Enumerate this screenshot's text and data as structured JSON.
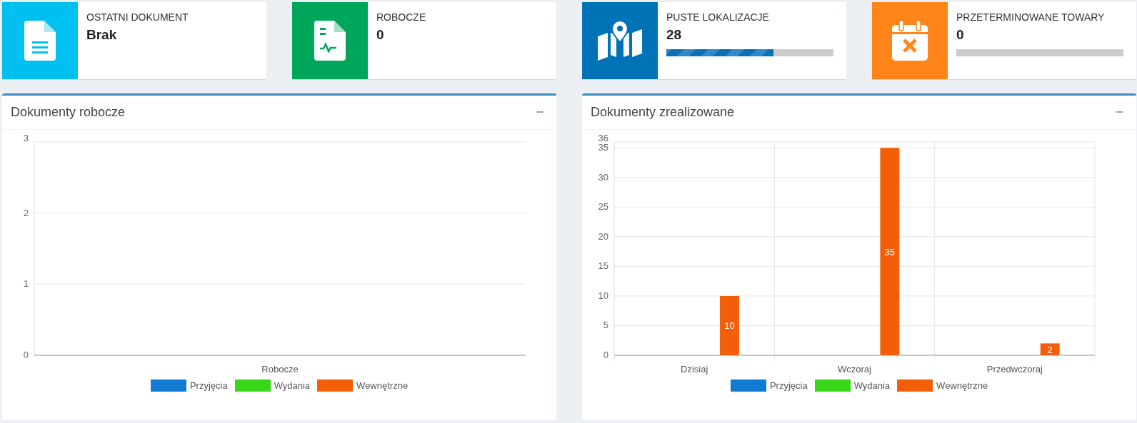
{
  "info_boxes": [
    {
      "kind": "document",
      "color": "#00c0ef",
      "title": "OSTATNI DOKUMENT",
      "value": "Brak"
    },
    {
      "kind": "signed",
      "color": "#00a65a",
      "title": "ROBOCZE",
      "value": "0"
    },
    {
      "kind": "map",
      "color": "#0073b7",
      "title": "PUSTE LOKALIZACJE",
      "value": "28",
      "level": 0.64
    },
    {
      "kind": "calendar",
      "color": "#ff851b",
      "title": "PRZETERMINOWANE TOWARY",
      "value": "0",
      "level": 0
    }
  ],
  "panels": [
    {
      "title": "Dokumenty robocze",
      "collapse": "−",
      "chart_data": {
        "type": "bar",
        "categories": [
          "Robocze"
        ],
        "series": [
          {
            "name": "Przyjęcia",
            "color": "#127ad2",
            "values": [
              0
            ]
          },
          {
            "name": "Wydania",
            "color": "#3ad618",
            "values": [
              0
            ]
          },
          {
            "name": "Wewnętrzne",
            "color": "#f35f08",
            "values": [
              0
            ]
          }
        ],
        "ylim": [
          0,
          3
        ],
        "yticks": [
          0,
          1,
          2,
          3
        ],
        "grid": true
      }
    },
    {
      "title": "Dokumenty zrealizowane",
      "collapse": "−",
      "chart_data": {
        "type": "bar",
        "categories": [
          "Dzisiaj",
          "Wczoraj",
          "Przedwczoraj"
        ],
        "series": [
          {
            "name": "Przyjęcia",
            "color": "#127ad2",
            "values": [
              0,
              0,
              0
            ]
          },
          {
            "name": "Wydania",
            "color": "#3ad618",
            "values": [
              0,
              0,
              0
            ]
          },
          {
            "name": "Wewnętrzne",
            "color": "#f35f08",
            "values": [
              10,
              35,
              2
            ]
          }
        ],
        "ylim": [
          0,
          36
        ],
        "yticks": [
          0,
          5,
          10,
          15,
          20,
          25,
          30,
          35,
          36
        ],
        "grid": true,
        "value_labels": [
          [
            null,
            null,
            null
          ],
          [
            null,
            null,
            null
          ],
          [
            "10",
            "35",
            "2"
          ]
        ]
      }
    }
  ]
}
